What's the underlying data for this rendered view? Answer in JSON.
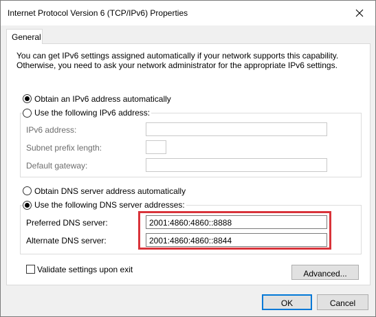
{
  "window": {
    "title": "Internet Protocol Version 6 (TCP/IPv6) Properties"
  },
  "tabs": [
    {
      "label": "General"
    }
  ],
  "description": {
    "line1": "You can get IPv6 settings assigned automatically if your network supports this capability.",
    "line2": "Otherwise, you need to ask your network administrator for the appropriate IPv6 settings."
  },
  "ip": {
    "auto_label": "Obtain an IPv6 address automatically",
    "auto_selected": true,
    "manual_label": "Use the following IPv6 address:",
    "fields": {
      "address_label": "IPv6 address:",
      "prefix_label": "Subnet prefix length:",
      "gateway_label": "Default gateway:",
      "address_value": "",
      "prefix_value": "",
      "gateway_value": ""
    }
  },
  "dns": {
    "auto_label": "Obtain DNS server address automatically",
    "manual_label": "Use the following DNS server addresses:",
    "manual_selected": true,
    "preferred_label": "Preferred DNS server:",
    "preferred_value": "2001:4860:4860::8888",
    "alternate_label": "Alternate DNS server:",
    "alternate_value": "2001:4860:4860::8844"
  },
  "validate": {
    "label": "Validate settings upon exit",
    "checked": false
  },
  "buttons": {
    "advanced": "Advanced...",
    "ok": "OK",
    "cancel": "Cancel"
  },
  "colors": {
    "highlight": "#d9333a",
    "default_button_border": "#0078d7"
  }
}
